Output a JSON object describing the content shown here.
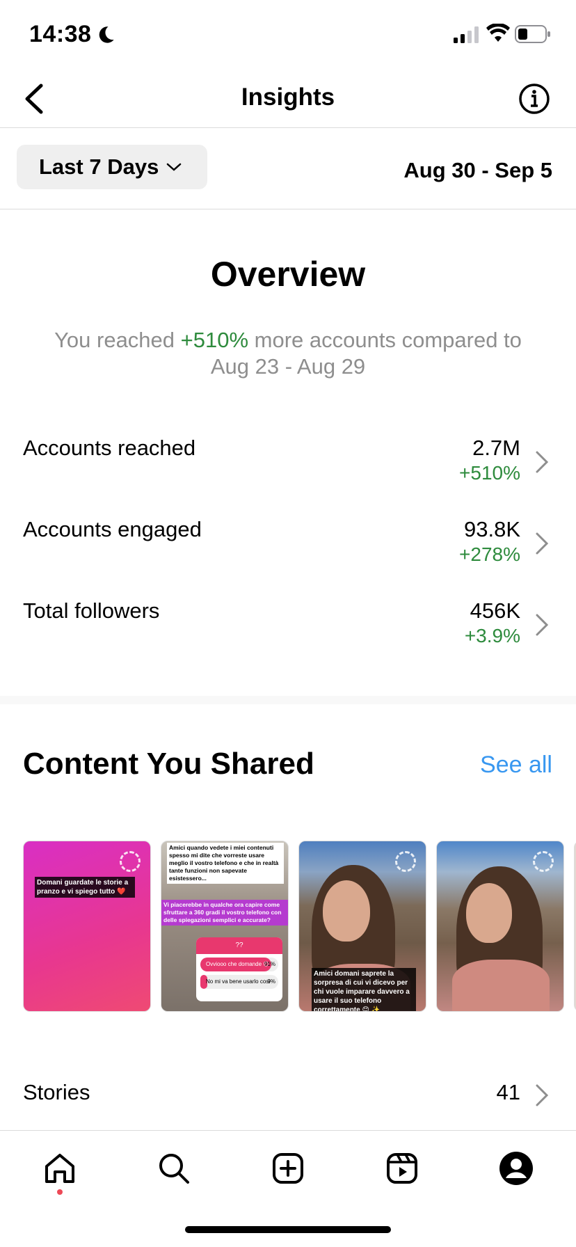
{
  "status_bar": {
    "time": "14:38"
  },
  "header": {
    "title": "Insights"
  },
  "filter": {
    "range_label": "Last 7 Days",
    "date_range": "Aug 30 - Sep 5"
  },
  "overview": {
    "title": "Overview",
    "summary_prefix": "You reached ",
    "summary_highlight": "+510%",
    "summary_suffix": " more accounts compared to Aug 23 - Aug 29",
    "metrics": [
      {
        "label": "Accounts reached",
        "value": "2.7M",
        "change": "+510%"
      },
      {
        "label": "Accounts engaged",
        "value": "93.8K",
        "change": "+278%"
      },
      {
        "label": "Total followers",
        "value": "456K",
        "change": "+3.9%"
      }
    ]
  },
  "content": {
    "title": "Content You Shared",
    "see_all": "See all",
    "thumbs": [
      {
        "caption": "Domani guardate le storie a pranzo e vi spiego tutto ❤️"
      },
      {
        "caption_top": "Amici quando vedete i miei contenuti spesso mi dite che vorreste usare meglio il vostro telefono e che in realtà tante funzioni non sapevate esistessero...",
        "caption_mid": "Vi piacerebbe in qualche ora capire come sfruttare a 360 gradi il vostro telefono con delle spiegazioni semplici e accurate?",
        "poll_head": "??",
        "poll_options": [
          {
            "label": "Ovviooo che domande 😍",
            "pct": "91%",
            "fraction": 0.91
          },
          {
            "label": "No mi va bene usarlo così",
            "pct": "9%",
            "fraction": 0.09
          }
        ]
      },
      {
        "caption": "Amici domani saprete la sorpresa di cui vi dicevo per chi vuole imparare davvero a usare il suo telefono correttamente 😊 ✨"
      },
      {
        "caption": ""
      }
    ]
  },
  "stories": {
    "label": "Stories",
    "count": "41"
  }
}
